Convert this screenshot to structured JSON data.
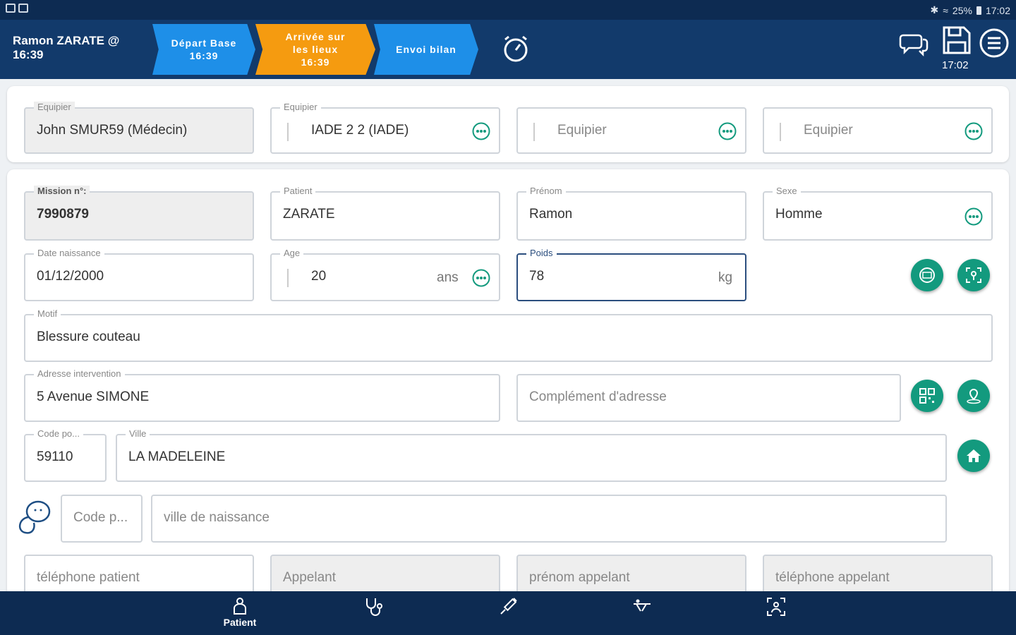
{
  "status": {
    "bluetooth": "✱",
    "battery": "25%",
    "time": "17:02"
  },
  "header": {
    "user_line1": "Ramon ZARATE @",
    "user_line2": "16:39",
    "steps": [
      {
        "label": "Départ Base",
        "time": "16:39"
      },
      {
        "label": "Arrivée sur les lieux",
        "time": "16:39"
      },
      {
        "label": "Envoi bilan",
        "time": ""
      }
    ],
    "save_time": "17:02"
  },
  "team": [
    {
      "label": "Equipier",
      "value": "John SMUR59 (Médecin)"
    },
    {
      "label": "Equipier",
      "value": "IADE 2 2 (IADE)"
    },
    {
      "label": "",
      "value": "Equipier"
    },
    {
      "label": "",
      "value": "Equipier"
    }
  ],
  "form": {
    "mission": {
      "label": "Mission n°:",
      "value": "7990879"
    },
    "patient": {
      "label": "Patient",
      "value": "ZARATE"
    },
    "prenom": {
      "label": "Prénom",
      "value": "Ramon"
    },
    "sexe": {
      "label": "Sexe",
      "value": "Homme"
    },
    "naissance": {
      "label": "Date naissance",
      "value": "01/12/2000"
    },
    "age": {
      "label": "Age",
      "value": "20",
      "unit": "ans"
    },
    "poids": {
      "label": "Poids",
      "value": "78",
      "unit": "kg"
    },
    "motif": {
      "label": "Motif",
      "value": "Blessure couteau"
    },
    "adresse": {
      "label": "Adresse intervention",
      "value": "5 Avenue SIMONE"
    },
    "complement": {
      "placeholder": "Complément d'adresse"
    },
    "code_postal": {
      "label": "Code po...",
      "value": "59110"
    },
    "ville": {
      "label": "Ville",
      "value": "LA MADELEINE"
    },
    "code_naissance": {
      "placeholder": "Code p..."
    },
    "ville_naissance": {
      "placeholder": "ville de naissance"
    },
    "tel_patient": {
      "placeholder": "téléphone patient"
    },
    "appelant": {
      "placeholder": "Appelant"
    },
    "prenom_appelant": {
      "placeholder": "prénom appelant"
    },
    "tel_appelant": {
      "placeholder": "téléphone appelant"
    }
  },
  "nav": [
    {
      "label": "Patient",
      "icon": "patient-icon"
    },
    {
      "label": "",
      "icon": "stethoscope-icon"
    },
    {
      "label": "",
      "icon": "syringe-icon"
    },
    {
      "label": "",
      "icon": "stretcher-icon"
    },
    {
      "label": "",
      "icon": "scan-icon"
    }
  ],
  "colors": {
    "header": "#123a6b",
    "step_blue": "#1e8fe8",
    "step_orange": "#f59b10",
    "fab_green": "#139a7e"
  }
}
